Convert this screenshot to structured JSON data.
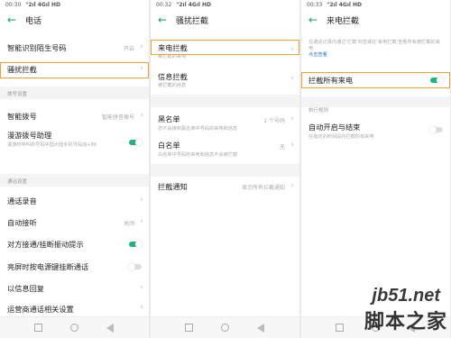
{
  "panel1": {
    "status_time": "00:30",
    "status_icons": "\"2ıl 4Gıl HD",
    "title": "电话",
    "rows": {
      "smart_id": {
        "label": "智能识别陌生号码",
        "value": "开启"
      },
      "block": {
        "label": "骚扰拦截"
      },
      "smart_dial": {
        "label": "智能拨号",
        "value": "智能拼音拨号"
      },
      "roaming": {
        "label": "漫游拨号助理",
        "sub": "漫游时呼叫的号码中国大陆手机号码加+86"
      },
      "record": {
        "label": "通话录音"
      },
      "auto_answer": {
        "label": "自动接听",
        "value": "关闭"
      },
      "vibrate": {
        "label": "对方接通/挂断振动提示"
      },
      "power_end": {
        "label": "亮屏时按电源键挂断通话"
      },
      "sms_reply": {
        "label": "以信息回复"
      },
      "carrier": {
        "label": "运营商通话相关设置"
      }
    },
    "sections": {
      "dial": "拨号设置",
      "call": "通话设置"
    }
  },
  "panel2": {
    "status_time": "00:32",
    "status_icons": "\"2ıl 4Gıl HD",
    "title": "骚扰拦截",
    "rows": {
      "incoming": {
        "label": "来电拦截",
        "sub": "被拦截的来电"
      },
      "sms": {
        "label": "信息拦截",
        "sub": "被拦截的信息"
      },
      "blacklist": {
        "label": "黑名单",
        "value": "1 个号码",
        "sub": "您不会接到黑名单中号码的来电和信息"
      },
      "whitelist": {
        "label": "白名单",
        "value": "无",
        "sub": "白名单中号码的来电和信息不会被拦截"
      },
      "notify": {
        "label": "拦截通知",
        "value": "显示所有拦截通知"
      }
    }
  },
  "panel3": {
    "status_time": "00:33",
    "status_icons": "\"2ıl 4Gıl HD",
    "title": "来电拦截",
    "note": "在通话记录内通过'拦截'标签或在'来电拦截'查看所有被拦截的来电",
    "note_link": "点击查看",
    "rows": {
      "block_all": {
        "label": "拦截所有来电"
      },
      "auto_schedule": {
        "label": "自动开启与结束",
        "sub": "在指定的时间段内拦截所有来电"
      }
    },
    "section": "执行规则"
  },
  "watermark": {
    "url": "jb51.net",
    "cn": "脚本之家"
  },
  "colors": {
    "accent": "#1bb57f",
    "highlight": "#f0a030",
    "link": "#2f78c8"
  }
}
